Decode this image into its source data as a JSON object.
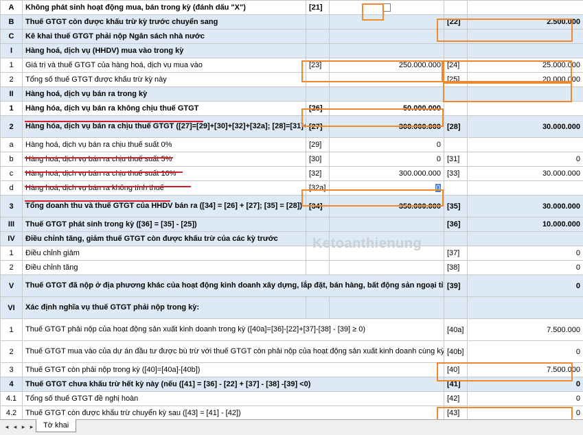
{
  "rows": [
    {
      "code": "A",
      "desc": "Không phát sinh hoạt động mua, bán trong kỳ (đánh dấu \"X\")",
      "ref1": "[21]",
      "val1": "",
      "ref2": "",
      "val2": "",
      "bold": true,
      "checkbox": true
    },
    {
      "code": "B",
      "desc": "Thuế GTGT còn được khấu trừ kỳ trước chuyển sang",
      "ref1": "",
      "val1": "",
      "ref2": "[22]",
      "val2": "2.500.000",
      "bold": true,
      "shade": true
    },
    {
      "code": "C",
      "desc": "Kê khai thuế GTGT phải nộp Ngân sách nhà nước",
      "ref1": "",
      "val1": "",
      "ref2": "",
      "val2": "",
      "bold": true,
      "shade": true
    },
    {
      "code": "I",
      "desc": "Hàng hoá, dịch vụ (HHDV) mua vào trong kỳ",
      "ref1": "",
      "val1": "",
      "ref2": "",
      "val2": "",
      "bold": true,
      "shade": true
    },
    {
      "code": "1",
      "desc": "Giá trị và thuế GTGT của hàng hoá, dịch vụ mua vào",
      "ref1": "[23]",
      "val1": "250.000.000",
      "ref2": "[24]",
      "val2": "25.000.000",
      "bold": false
    },
    {
      "code": "2",
      "desc": "Tổng số thuế GTGT  được khấu trừ kỳ này",
      "ref1": "",
      "val1": "",
      "ref2": "[25]",
      "val2": "20.000.000",
      "bold": false
    },
    {
      "code": "II",
      "desc": "Hàng hoá, dịch vụ bán ra trong kỳ",
      "ref1": "",
      "val1": "",
      "ref2": "",
      "val2": "",
      "bold": true,
      "shade": true
    },
    {
      "code": "1",
      "desc": "Hàng hóa, dịch vụ bán ra không chịu thuế GTGT",
      "ref1": "[26]",
      "val1": "50.000.000",
      "ref2": "",
      "val2": "",
      "bold": true
    },
    {
      "code": "2",
      "desc": "Hàng hóa, dịch vụ bán ra chịu thuế GTGT ([27]=[29]+[30]+[32]+[32a]; [28]=[31]+[33])",
      "ref1": "[27]",
      "val1": "300.000.000",
      "ref2": "[28]",
      "val2": "30.000.000",
      "bold": true,
      "shade": true,
      "tall": true
    },
    {
      "code": "a",
      "desc": "Hàng hoá, dịch vụ bán ra chịu thuế suất 0%",
      "ref1": "[29]",
      "val1": "0",
      "ref2": "",
      "val2": "",
      "bold": false
    },
    {
      "code": "b",
      "desc": "Hàng hoá, dịch vụ bán ra chịu thuế suất 5%",
      "ref1": "[30]",
      "val1": "0",
      "ref2": "[31]",
      "val2": "0",
      "bold": false
    },
    {
      "code": "c",
      "desc": "Hàng hoá, dịch vụ bán ra chịu thuế suất 10%",
      "ref1": "[32]",
      "val1": "300.000.000",
      "ref2": "[33]",
      "val2": "30.000.000",
      "bold": false
    },
    {
      "code": "d",
      "desc": "Hàng hoá, dịch vụ bán ra không tính thuế",
      "ref1": "[32a]",
      "val1": "0",
      "ref2": "",
      "val2": "",
      "bold": false
    },
    {
      "code": "3",
      "desc": "Tổng doanh thu và thuế GTGT của HHDV bán  ra ([34] = [26] + [27]; [35] = [28])",
      "ref1": "[34]",
      "val1": "350.000.000",
      "ref2": "[35]",
      "val2": "30.000.000",
      "bold": true,
      "shade": true,
      "tall": true
    },
    {
      "code": "III",
      "desc": "Thuế GTGT phát sinh trong kỳ ([36] = [35] - [25])",
      "ref1": "",
      "val1": "",
      "ref2": "[36]",
      "val2": "10.000.000",
      "bold": true,
      "shade": true
    },
    {
      "code": "IV",
      "desc": "Điều chỉnh tăng, giảm thuế GTGT còn được khấu trừ của các kỳ trước",
      "ref1": "",
      "val1": "",
      "ref2": "",
      "val2": "",
      "bold": true,
      "shade": true
    },
    {
      "code": "1",
      "desc": "Điều chỉnh giảm",
      "ref1": "",
      "val1": "",
      "ref2": "[37]",
      "val2": "0",
      "bold": false
    },
    {
      "code": "2",
      "desc": "Điều chỉnh tăng",
      "ref1": "",
      "val1": "",
      "ref2": "[38]",
      "val2": "0",
      "bold": false
    },
    {
      "code": "V",
      "desc": "Thuế GTGT đã nộp ở địa phương khác của hoạt động kinh doanh xây dựng, lắp đặt, bán hàng, bất động sản ngoại tỉnh",
      "ref1": "",
      "val1": "",
      "ref2": "[39]",
      "val2": "0",
      "bold": true,
      "shade": true,
      "tall": true,
      "merge": true
    },
    {
      "code": "VI",
      "desc": "Xác định nghĩa vụ thuế GTGT phải nộp trong kỳ:",
      "ref1": "",
      "val1": "",
      "ref2": "",
      "val2": "",
      "bold": true,
      "shade": true,
      "tall": true
    },
    {
      "code": "1",
      "desc": "Thuế GTGT phải nộp của hoạt động sản xuất kinh doanh trong kỳ ([40a]=[36]-[22]+[37]-[38] - [39] ≥ 0)",
      "ref1": "",
      "val1": "",
      "ref2": "[40a]",
      "val2": "7.500.000",
      "bold": false,
      "tall": true,
      "merge": true
    },
    {
      "code": "2",
      "desc": "Thuế GTGT mua vào của dự án đầu tư được bù trừ với thuế GTGT còn phải nộp của hoạt động sản xuất kinh doanh cùng kỳ tính thuế",
      "ref1": "",
      "val1": "",
      "ref2": "[40b]",
      "val2": "0",
      "bold": false,
      "tall": true,
      "merge": true
    },
    {
      "code": "3",
      "desc": "Thuế GTGT còn phải nộp trong kỳ ([40]=[40a]-[40b])",
      "ref1": "",
      "val1": "",
      "ref2": "[40]",
      "val2": "7.500.000",
      "bold": false,
      "merge": true
    },
    {
      "code": "4",
      "desc": "Thuế GTGT chưa khấu trừ hết kỳ này (nếu ([41] = [36] - [22] + [37] - [38] -[39] <0)",
      "ref1": "",
      "val1": "",
      "ref2": "[41]",
      "val2": "0",
      "bold": true,
      "shade": true,
      "merge": true
    },
    {
      "code": "4.1",
      "desc": "Tổng số thuế GTGT đề nghị hoàn",
      "ref1": "",
      "val1": "",
      "ref2": "[42]",
      "val2": "0",
      "bold": false,
      "merge": true
    },
    {
      "code": "4.2",
      "desc": "Thuế GTGT còn được khấu trừ chuyển kỳ sau ([43] = [41] - [42])",
      "ref1": "",
      "val1": "",
      "ref2": "[43]",
      "val2": "0",
      "bold": false,
      "merge": true
    }
  ],
  "watermark": "Ketoanthienung",
  "sheet_tab": "Tờ khai",
  "nav_icons": {
    "first": "◂",
    "prev": "◂",
    "next": "▸",
    "last": "▸"
  },
  "colors": {
    "highlight": "#f0882c",
    "underline": "#d0202a",
    "shade": "#dde9f5"
  }
}
